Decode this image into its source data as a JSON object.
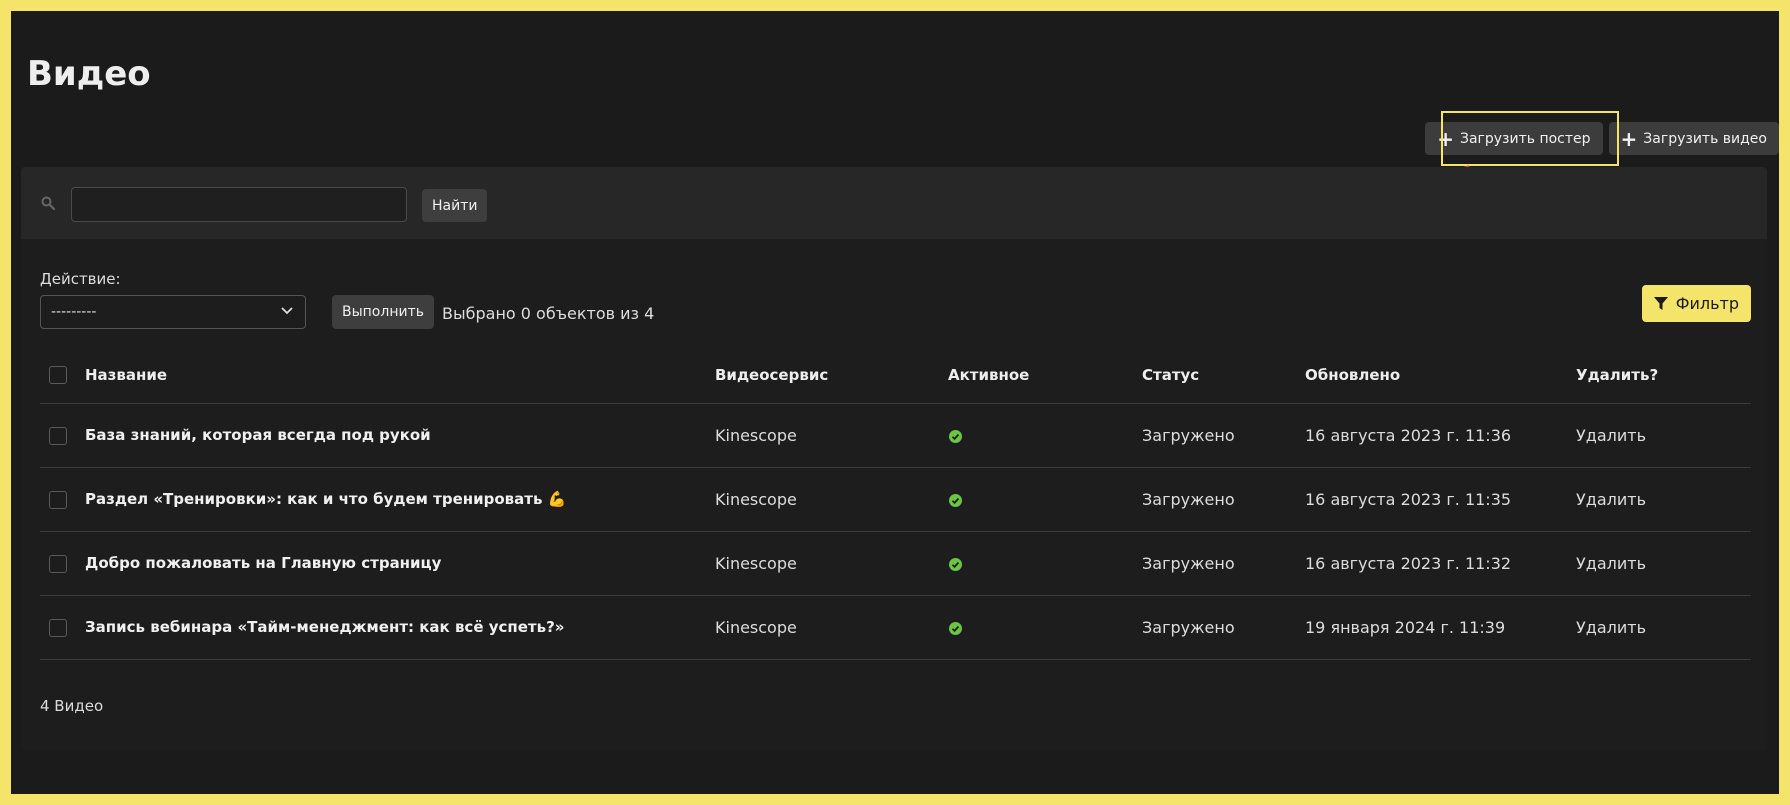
{
  "page": {
    "title": "Видео"
  },
  "tools": {
    "upload_poster": "Загрузить постер",
    "upload_video": "Загрузить видео"
  },
  "search": {
    "value": "",
    "button": "Найти"
  },
  "actions": {
    "label": "Действие:",
    "selected_option": "---------",
    "run_button": "Выполнить",
    "selected_text": "Выбрано 0 объектов из 4"
  },
  "filter": {
    "label": "Фильтр"
  },
  "table": {
    "headers": {
      "name": "Название",
      "service": "Видеосервис",
      "active": "Активное",
      "status": "Статус",
      "updated": "Обновлено",
      "delete": "Удалить?"
    },
    "rows": [
      {
        "name": "База знаний, которая всегда под рукой",
        "service": "Kinescope",
        "status": "Загружено",
        "updated": "16 августа 2023 г. 11:36",
        "delete": "Удалить"
      },
      {
        "name": "Раздел «Тренировки»: как и что будем тренировать 💪",
        "service": "Kinescope",
        "status": "Загружено",
        "updated": "16 августа 2023 г. 11:35",
        "delete": "Удалить"
      },
      {
        "name": "Добро пожаловать на Главную страницу",
        "service": "Kinescope",
        "status": "Загружено",
        "updated": "16 августа 2023 г. 11:32",
        "delete": "Удалить"
      },
      {
        "name": "Запись вебинара «Тайм-менеджмент: как всё успеть?»",
        "service": "Kinescope",
        "status": "Загружено",
        "updated": "19 января 2024 г. 11:39",
        "delete": "Удалить"
      }
    ]
  },
  "paginator": {
    "text": "4 Видео"
  },
  "colors": {
    "accent": "#f5e46a",
    "background": "#1b1b1b",
    "ok": "#6cc644",
    "arrow": "#e0345a"
  }
}
